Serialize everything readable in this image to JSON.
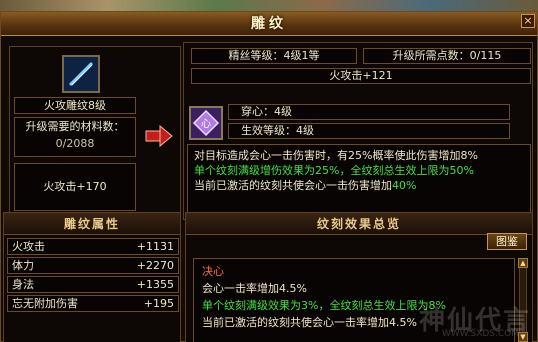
{
  "window": {
    "title": "雕纹",
    "close": "×"
  },
  "item": {
    "name": "火攻雕纹8级",
    "need_label": "升级需要的材料数：",
    "need_value": "0/2088",
    "bonus": "火攻击+170",
    "icon": "blue-blade-icon"
  },
  "upgrade": {
    "refine_level": "精丝等级：4级1等",
    "points_needed": "升级所需点数：0/115",
    "target_bonus": "火攻击+121",
    "gem_icon": "purple-gem-icon",
    "attr_name": "穿心：4级",
    "attr_level": "生效等级：4级",
    "desc": [
      {
        "text": "对目标造成会心一击伤害时，有25%概率使此伤害增加8%",
        "color": "white"
      },
      {
        "text": "单个纹刻满级增伤效果为25%，全纹刻总生效上限为50%",
        "color": "green"
      },
      {
        "text": "当前已激活的纹刻共使会心一击伤害增加",
        "color": "white",
        "suffix": "40%"
      }
    ]
  },
  "properties": {
    "header": "雕纹属性",
    "rows": [
      {
        "name": "火攻击",
        "value": "+1131"
      },
      {
        "name": "体力",
        "value": "+2270"
      },
      {
        "name": "身法",
        "value": "+1355"
      },
      {
        "name": "忘无附加伤害",
        "value": "+195"
      }
    ]
  },
  "effects": {
    "header": "纹刻效果总览",
    "button": "图鉴",
    "name": "决心",
    "lines": [
      {
        "text": "会心一击率增加4.5%",
        "color": "white"
      },
      {
        "text": "单个纹刻满级效果为3%，全纹刻总生效上限为8%",
        "color": "green"
      },
      {
        "text": "当前已激活的纹刻共使会心一击率增加4.5%",
        "color": "white"
      }
    ]
  },
  "watermark": {
    "text": "神仙代言",
    "url": "WWW.SXDS.COM"
  },
  "colors": {
    "accent": "#c8963e",
    "green": "#44e044",
    "red": "#ff6b3a"
  }
}
